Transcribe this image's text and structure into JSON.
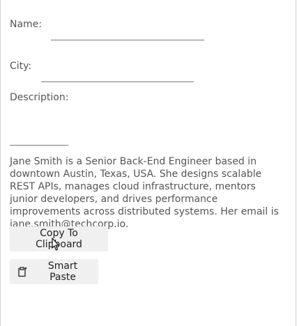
{
  "form": {
    "name_label": "Name:",
    "city_label": "City:",
    "description_label": "Description:"
  },
  "paragraph": {
    "text": "Jane Smith is a Senior Back-End Engineer based in downtown Austin, Texas, USA. She designs scalable REST APIs, manages cloud infrastructure, mentors junior developers, and drives performance improvements across distributed systems. Her email is jane.smith@techcorp.io."
  },
  "buttons": {
    "copy_label": "Copy To Clipboard",
    "smart_paste_label": "Smart Paste",
    "smart_paste_icon": "smart-paste-icon"
  }
}
